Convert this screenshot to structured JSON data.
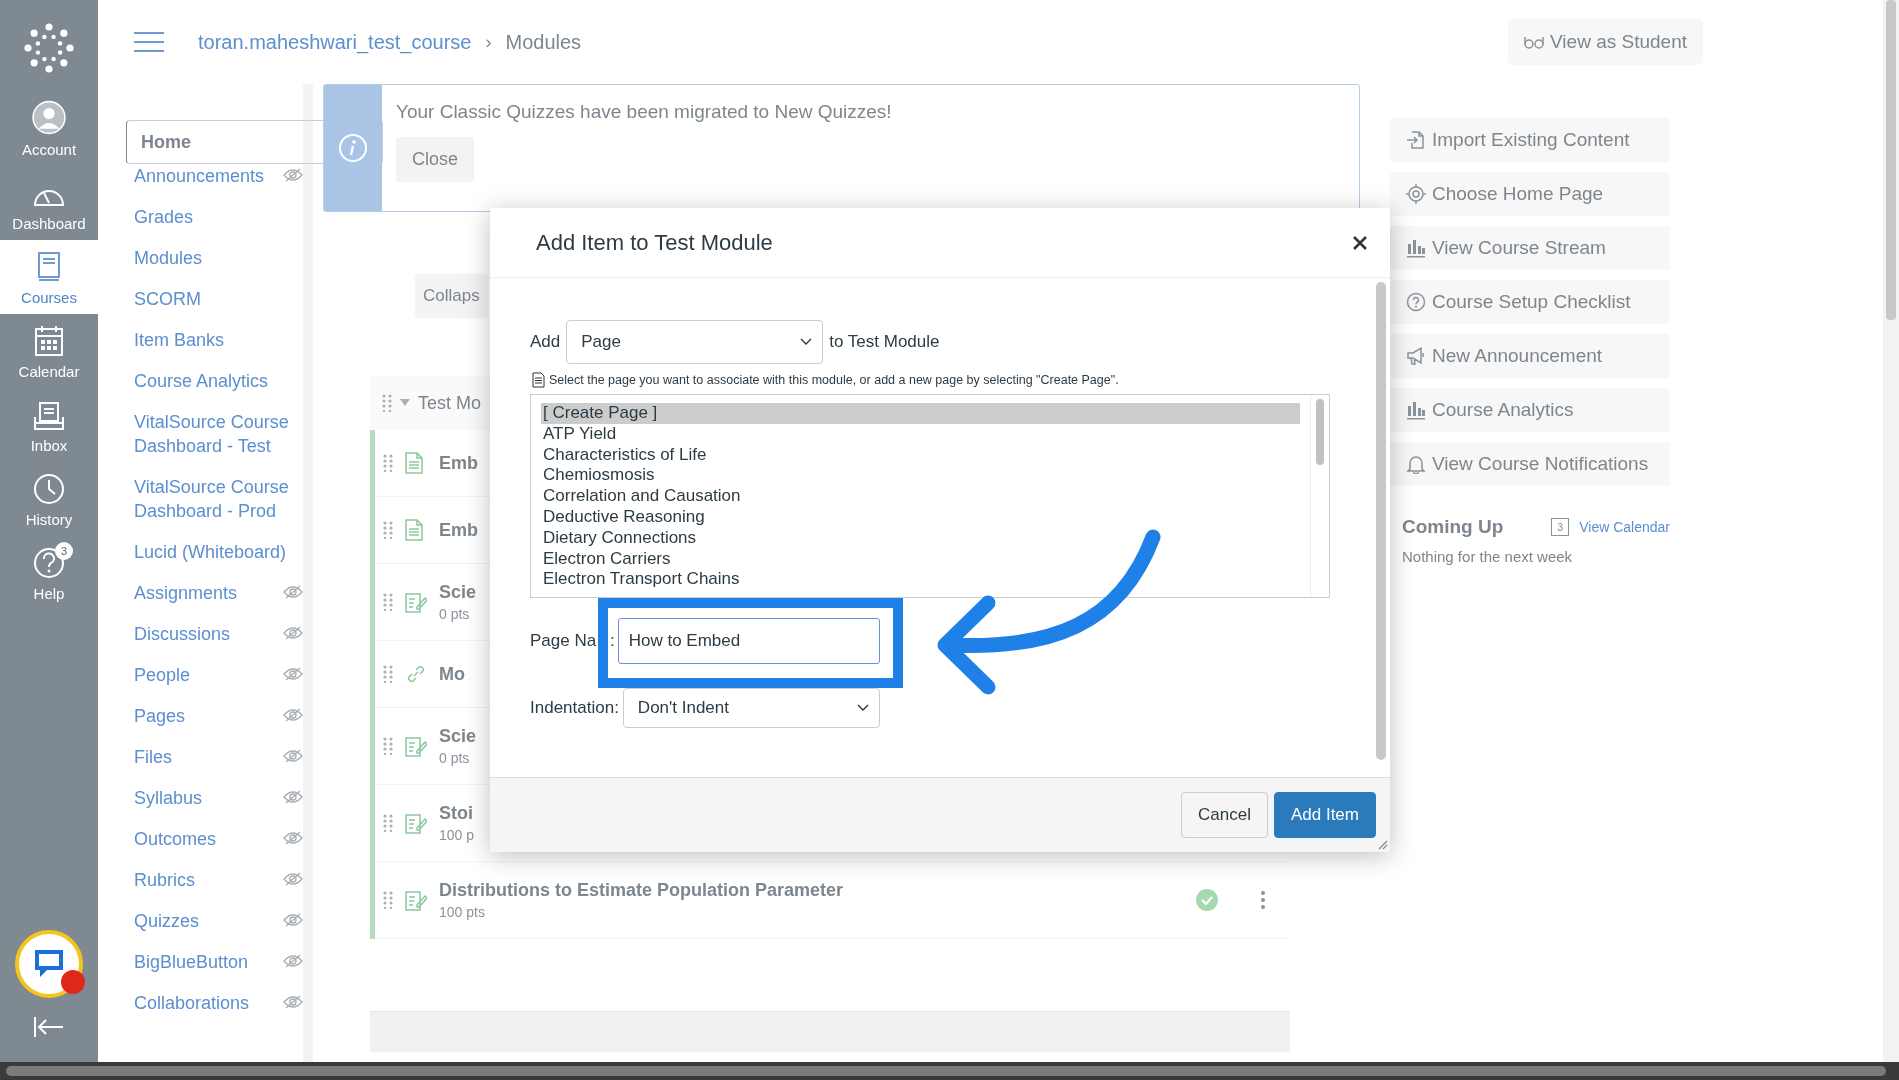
{
  "global_nav": {
    "items": [
      {
        "label": "Account",
        "selected": false
      },
      {
        "label": "Dashboard",
        "selected": false
      },
      {
        "label": "Courses",
        "selected": true
      },
      {
        "label": "Calendar",
        "selected": false
      },
      {
        "label": "Inbox",
        "selected": false
      },
      {
        "label": "History",
        "selected": false
      },
      {
        "label": "Help",
        "selected": false,
        "badge": "3"
      }
    ]
  },
  "breadcrumb": {
    "course": "toran.maheshwari_test_course",
    "separator": "›",
    "current": "Modules"
  },
  "view_as_student": "View as Student",
  "course_nav": [
    {
      "label": "Home",
      "selected": true,
      "hidden": false
    },
    {
      "label": "Announcements",
      "selected": false,
      "hidden": true
    },
    {
      "label": "Grades",
      "selected": false,
      "hidden": false
    },
    {
      "label": "Modules",
      "selected": false,
      "hidden": false
    },
    {
      "label": "SCORM",
      "selected": false,
      "hidden": false
    },
    {
      "label": "Item Banks",
      "selected": false,
      "hidden": false
    },
    {
      "label": "Course Analytics",
      "selected": false,
      "hidden": false
    },
    {
      "label": "VitalSource Course Dashboard - Test",
      "selected": false,
      "hidden": false
    },
    {
      "label": "VitalSource Course Dashboard - Prod",
      "selected": false,
      "hidden": false
    },
    {
      "label": "Lucid (Whiteboard)",
      "selected": false,
      "hidden": false
    },
    {
      "label": "Assignments",
      "selected": false,
      "hidden": true
    },
    {
      "label": "Discussions",
      "selected": false,
      "hidden": true
    },
    {
      "label": "People",
      "selected": false,
      "hidden": true
    },
    {
      "label": "Pages",
      "selected": false,
      "hidden": true
    },
    {
      "label": "Files",
      "selected": false,
      "hidden": true
    },
    {
      "label": "Syllabus",
      "selected": false,
      "hidden": true
    },
    {
      "label": "Outcomes",
      "selected": false,
      "hidden": true
    },
    {
      "label": "Rubrics",
      "selected": false,
      "hidden": true
    },
    {
      "label": "Quizzes",
      "selected": false,
      "hidden": true
    },
    {
      "label": "BigBlueButton",
      "selected": false,
      "hidden": true
    },
    {
      "label": "Collaborations",
      "selected": false,
      "hidden": true
    }
  ],
  "alert": {
    "message": "Your Classic Quizzes have been migrated to New Quizzes!",
    "button": "Close"
  },
  "collapse_button": "Collaps",
  "module": {
    "title": "Test Mo",
    "items": [
      {
        "kind": "page",
        "title": "Emb"
      },
      {
        "kind": "page",
        "title": "Emb"
      },
      {
        "kind": "quiz",
        "title": "Scie",
        "points": "0 pts"
      },
      {
        "kind": "link",
        "title": "Mo"
      },
      {
        "kind": "quiz",
        "title": "Scie",
        "points": "0 pts"
      },
      {
        "kind": "quiz",
        "title": "Stoi",
        "points": "100 p"
      },
      {
        "kind": "quiz",
        "title": "Distributions to Estimate Population Parameter",
        "points": "100 pts",
        "published": true
      }
    ]
  },
  "sidebar": {
    "buttons": [
      "Import Existing Content",
      "Choose Home Page",
      "View Course Stream",
      "Course Setup Checklist",
      "New Announcement",
      "Course Analytics",
      "View Course Notifications"
    ],
    "coming_up": {
      "title": "Coming Up",
      "calendar_day": "3",
      "link": "View Calendar",
      "empty": "Nothing for the next week"
    }
  },
  "dialog": {
    "title": "Add Item to Test Module",
    "add_label": "Add",
    "type": "Page",
    "to_label": "to Test Module",
    "hint": "Select the page you want to associate with this module, or add a new page by selecting \"Create Page\".",
    "pages": [
      {
        "label": "[ Create Page ]",
        "selected": true
      },
      {
        "label": "ATP Yield",
        "selected": false
      },
      {
        "label": "Characteristics of Life",
        "selected": false
      },
      {
        "label": "Chemiosmosis",
        "selected": false
      },
      {
        "label": "Correlation and Causation",
        "selected": false
      },
      {
        "label": "Deductive Reasoning",
        "selected": false
      },
      {
        "label": "Dietary Connections",
        "selected": false
      },
      {
        "label": "Electron Carriers",
        "selected": false
      },
      {
        "label": "Electron Transport Chains",
        "selected": false
      }
    ],
    "page_name_label": "Page Na",
    "page_name_colon": ":",
    "page_name": "How to Embed",
    "indentation_label": "Indentation:",
    "indentation": "Don't Indent",
    "buttons": [
      {
        "kind": "secondary",
        "label": "Cancel"
      },
      {
        "kind": "primary",
        "label": "Add Item"
      }
    ]
  }
}
